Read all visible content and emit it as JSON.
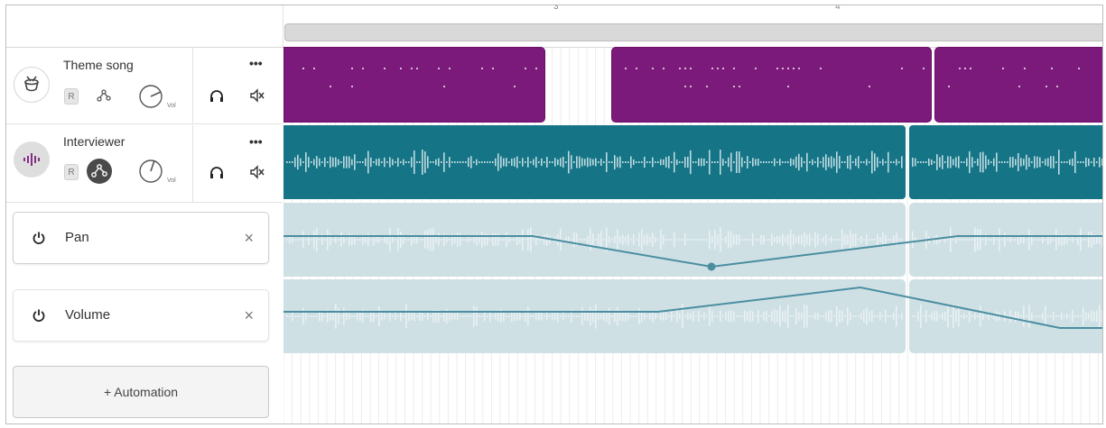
{
  "ruler": {
    "tick_3": "3",
    "tick_4": "4"
  },
  "tracks": [
    {
      "name": "Theme song",
      "record_label": "R",
      "volume_label": "Vol",
      "icon": "drum-icon",
      "color": "#7b1a7a"
    },
    {
      "name": "Interviewer",
      "record_label": "R",
      "volume_label": "Vol",
      "icon": "waveform-icon",
      "color": "#157486"
    }
  ],
  "automation": [
    {
      "label": "Pan"
    },
    {
      "label": "Volume"
    }
  ],
  "add_automation_label": "+ Automation",
  "colors": {
    "music_clip": "#7b1a7a",
    "voice_clip": "#157486",
    "automation_lane": "#cfe0e5",
    "automation_line": "#4a8ea0"
  }
}
